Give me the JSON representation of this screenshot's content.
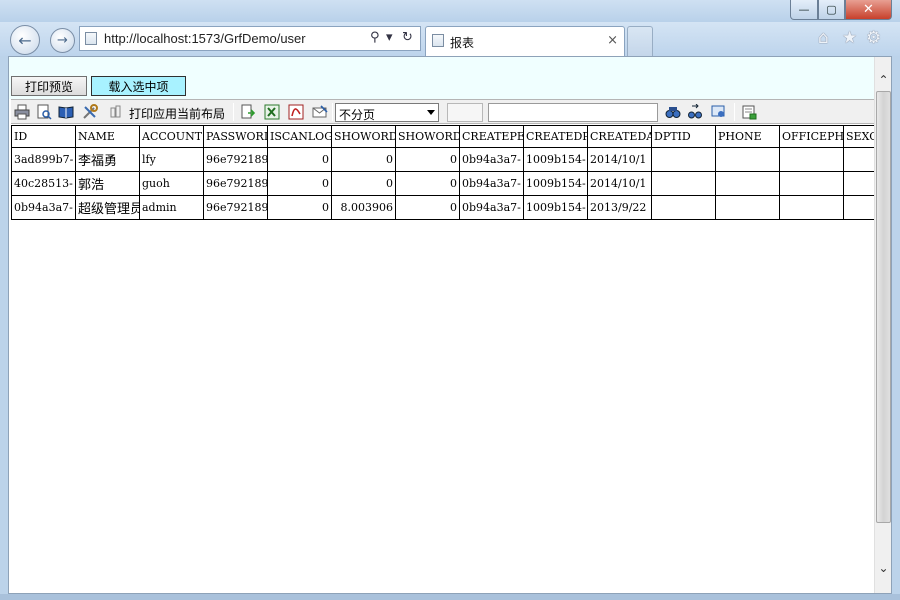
{
  "window": {
    "title": "",
    "minimize_label": "—",
    "maximize_label": "▢",
    "close_label": "✕"
  },
  "browser": {
    "back_glyph": "←",
    "forward_glyph": "→",
    "url": "http://localhost:1573/GrfDemo/user",
    "search_glyph": "⚲",
    "dropdown_glyph": "▾",
    "refresh_glyph": "↻",
    "tab_label": "报表",
    "tab_close": "×",
    "home_glyph": "⌂",
    "favorites_glyph": "★",
    "tools_glyph": "⚙"
  },
  "page": {
    "print_preview_label": "打印预览",
    "load_selected_label": "载入选中项"
  },
  "toolbar": {
    "apply_layout_label": "打印应用当前布局",
    "paging_select_value": "不分页",
    "page_number_value": "",
    "search_value": ""
  },
  "grid": {
    "columns": [
      "ID",
      "NAME",
      "ACCOUNT",
      "PASSWORD",
      "ISCANLOGI",
      "SHOWORDEF",
      "SHOWORDEF",
      "CREATEPEF",
      "CREATEDPT",
      "CREATEDAT",
      "DPTID",
      "PHONE",
      "OFFICEPHO",
      "SEXC"
    ],
    "rows": [
      [
        "3ad899b7-",
        "李福勇",
        "lfy",
        "96e792189",
        "0",
        "0",
        "0",
        "0b94a3a7-",
        "1009b154-",
        "2014/10/1",
        "",
        "",
        "",
        ""
      ],
      [
        "40c28513-",
        "郭浩",
        "guoh",
        "96e792189",
        "0",
        "0",
        "0",
        "0b94a3a7-",
        "1009b154-",
        "2014/10/1",
        "",
        "",
        "",
        ""
      ],
      [
        "0b94a3a7-",
        "超级管理员",
        "admin",
        "96e792189",
        "0",
        "8.003906",
        "0",
        "0b94a3a7-",
        "1009b154-",
        "2013/9/22",
        "",
        "",
        "",
        ""
      ]
    ]
  },
  "scrollbar": {
    "up_glyph": "⌃",
    "down_glyph": "⌄"
  }
}
